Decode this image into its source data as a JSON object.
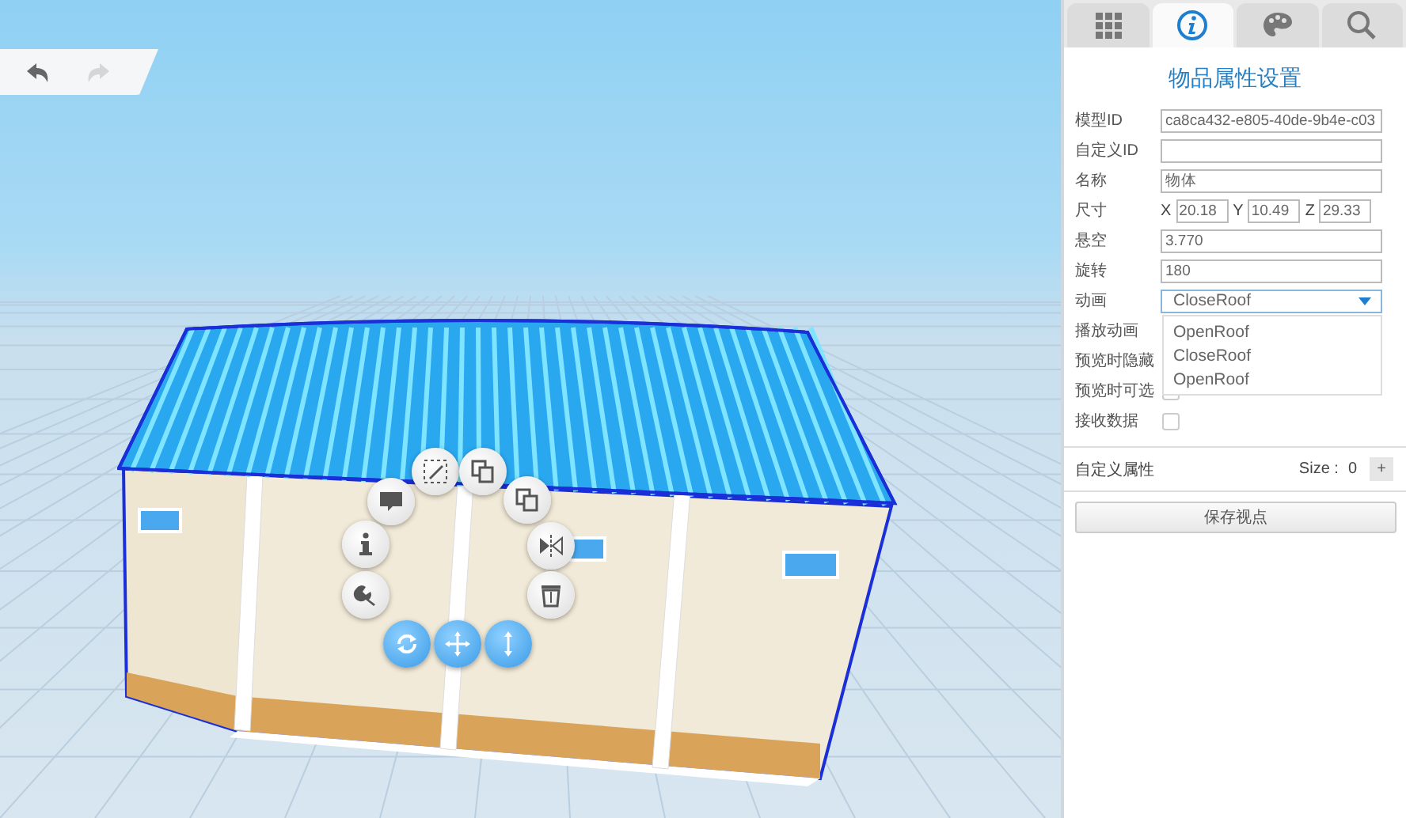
{
  "toolbar": {
    "undo": {
      "disabled": false
    },
    "redo": {
      "disabled": true
    }
  },
  "tabs": [
    {
      "selected": false
    },
    {
      "selected": true
    },
    {
      "selected": false
    },
    {
      "selected": false
    }
  ],
  "panel": {
    "title": "物品属性设置",
    "fields": [
      {
        "kind": "text",
        "label": "模型ID",
        "value": "ca8ca432-e805-40de-9b4e-c03"
      },
      {
        "kind": "text",
        "label": "自定义ID"
      },
      {
        "kind": "text",
        "label": "名称",
        "value": "物体"
      },
      {
        "kind": "xyz",
        "label": "尺寸",
        "axes": [
          {
            "axis": "X",
            "value": "20.18"
          },
          {
            "axis": "Y",
            "value": "10.49"
          },
          {
            "axis": "Z",
            "value": "29.33"
          }
        ]
      },
      {
        "kind": "text",
        "label": "悬空",
        "value": "3.770"
      },
      {
        "kind": "text",
        "label": "旋转",
        "value": "180"
      },
      {
        "kind": "select",
        "label": "动画",
        "value": "CloseRoof",
        "expanded": true,
        "options": [
          "OpenRoof",
          "CloseRoof",
          "OpenRoof"
        ]
      },
      {
        "kind": "checkbox",
        "label": "播放动画"
      },
      {
        "kind": "checkbox",
        "label": "预览时隐藏"
      },
      {
        "kind": "checkbox",
        "label": "预览时可选",
        "checked": false
      },
      {
        "kind": "checkbox",
        "label": "接收数据",
        "checked": false
      }
    ],
    "custom": {
      "label": "自定义属性",
      "size_label": "Size :",
      "size": "0",
      "add": "+"
    },
    "save_button": "保存视点"
  }
}
